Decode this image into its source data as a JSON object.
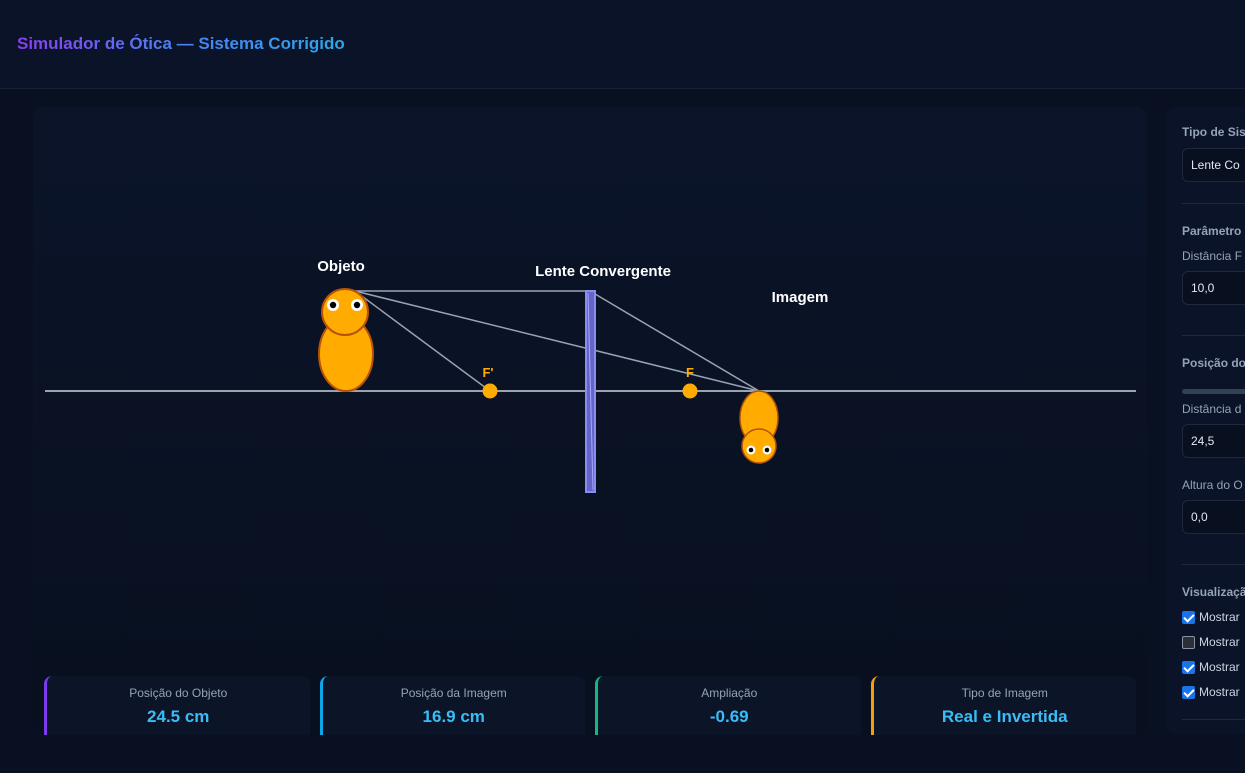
{
  "header": {
    "title": "Simulador de Ótica — Sistema Corrigido"
  },
  "simulation": {
    "object_label": "Objeto",
    "lens_label": "Lente Convergente",
    "image_label": "Imagem",
    "focal_left_label": "F'",
    "focal_right_label": "F"
  },
  "stats": [
    {
      "label": "Posição do Objeto",
      "value": "24.5 cm",
      "accent": "#7c3aed"
    },
    {
      "label": "Posição da Imagem",
      "value": "16.9 cm",
      "accent": "#0ea5e9"
    },
    {
      "label": "Ampliação",
      "value": "-0.69",
      "accent": "#10b981"
    },
    {
      "label": "Tipo de Imagem",
      "value": "Real e Invertida",
      "accent": "#f59e0b"
    }
  ],
  "controls": {
    "system_type_heading": "Tipo de Sis",
    "system_type_value": "Lente Co",
    "params_heading": "Parâmetro",
    "focal_distance_label": "Distância F",
    "focal_distance_value": "10,0",
    "position_heading": "Posição do",
    "object_distance_label": "Distância d",
    "object_distance_value": "24,5",
    "object_height_label": "Altura do O",
    "object_height_value": "0,0",
    "visualization_heading": "Visualizaçã",
    "checkboxes": [
      {
        "label": "Mostrar",
        "checked": true
      },
      {
        "label": "Mostrar",
        "checked": false
      },
      {
        "label": "Mostrar",
        "checked": true
      },
      {
        "label": "Mostrar",
        "checked": true
      }
    ]
  },
  "colors": {
    "accent_orange": "#ffab00",
    "lens": "#8b8cf0",
    "axis": "#9aa3b2",
    "value_text": "#38bdf8"
  }
}
